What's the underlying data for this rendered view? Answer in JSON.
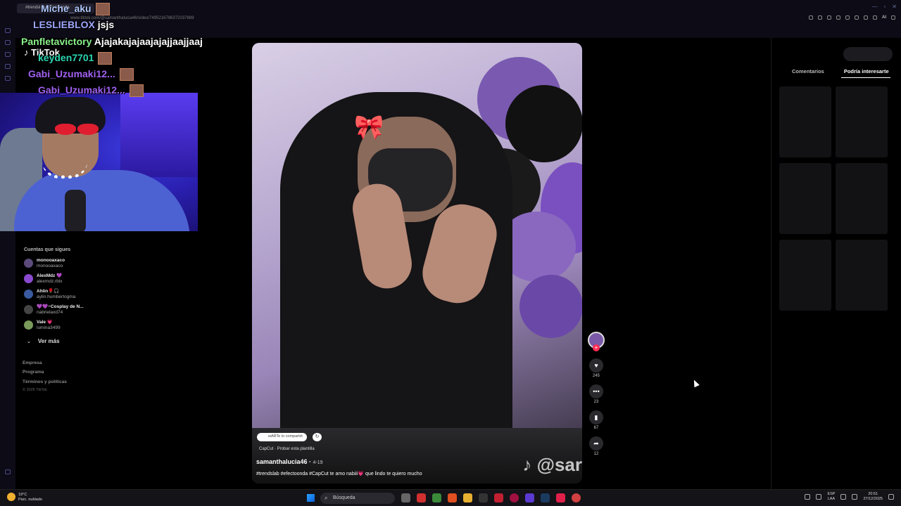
{
  "browser": {
    "tab_title": "#trendslab #efectoonda",
    "url": "www.tiktok.com/@samanthalucia46/video/7495216786372037889",
    "ai_label": "AI"
  },
  "chat": [
    {
      "user": "Miche_aku",
      "message": "",
      "color": "#b0c8ff"
    },
    {
      "user": "LESLIEBLOX",
      "message": "jsjs",
      "color": "#9fa8ff"
    },
    {
      "user": "Panfletavictory",
      "message": "Ajajakajajaajajajjaajjaaj",
      "color": "#8af08a"
    },
    {
      "user": "keyden7701",
      "message": "",
      "color": "#2ad5b0"
    },
    {
      "user": "Gabi_Uzumaki12...",
      "message": "",
      "color": "#a060f0"
    },
    {
      "user": "Gabi_Uzumaki12...",
      "message": "",
      "color": "#a060f0"
    }
  ],
  "tiktok_logo": "TikTok",
  "sidebar": {
    "section_title": "Cuentas que sigues",
    "accounts": [
      {
        "name": "monooaxaco",
        "handle": "monooaxaco"
      },
      {
        "name": "AlexMdz 💜",
        "handle": "alexmdz.rblx"
      },
      {
        "name": "Ahlin🌹🎧",
        "handle": "aylin.humbertogma"
      },
      {
        "name": "💜💜~Cosplay de N...",
        "handle": "nabrielaxd74"
      },
      {
        "name": "Vale 💗",
        "handle": "lumina3499"
      }
    ],
    "more_label": "Ver más",
    "footer": [
      "Empresa",
      "Programa",
      "Términos y políticas"
    ],
    "copyright": "© 2025 TikTok"
  },
  "video": {
    "shared_label": "wARTe lo compartió",
    "template_label": "CapCut · Probar esta plantilla",
    "author": "samanthalucia46",
    "date": "4-19",
    "caption": "#trendslab #efectoonda #CapCut  te amo nabiii💗  que lindo te quiero mucho",
    "watermark": "@sar"
  },
  "actions": {
    "likes": "245",
    "comments": "23",
    "saves": "67",
    "shares": "12"
  },
  "right_panel": {
    "tabs": [
      "Comentarios",
      "Podría interesarte"
    ],
    "active_tab": "Podría interesarte"
  },
  "taskbar": {
    "weather_temp": "19°C",
    "weather_desc": "Parc. nublado",
    "search_placeholder": "Búsqueda",
    "lang": "ESP",
    "lang_sub": "LAA",
    "time": "20:51",
    "date": "27/12/2025"
  }
}
